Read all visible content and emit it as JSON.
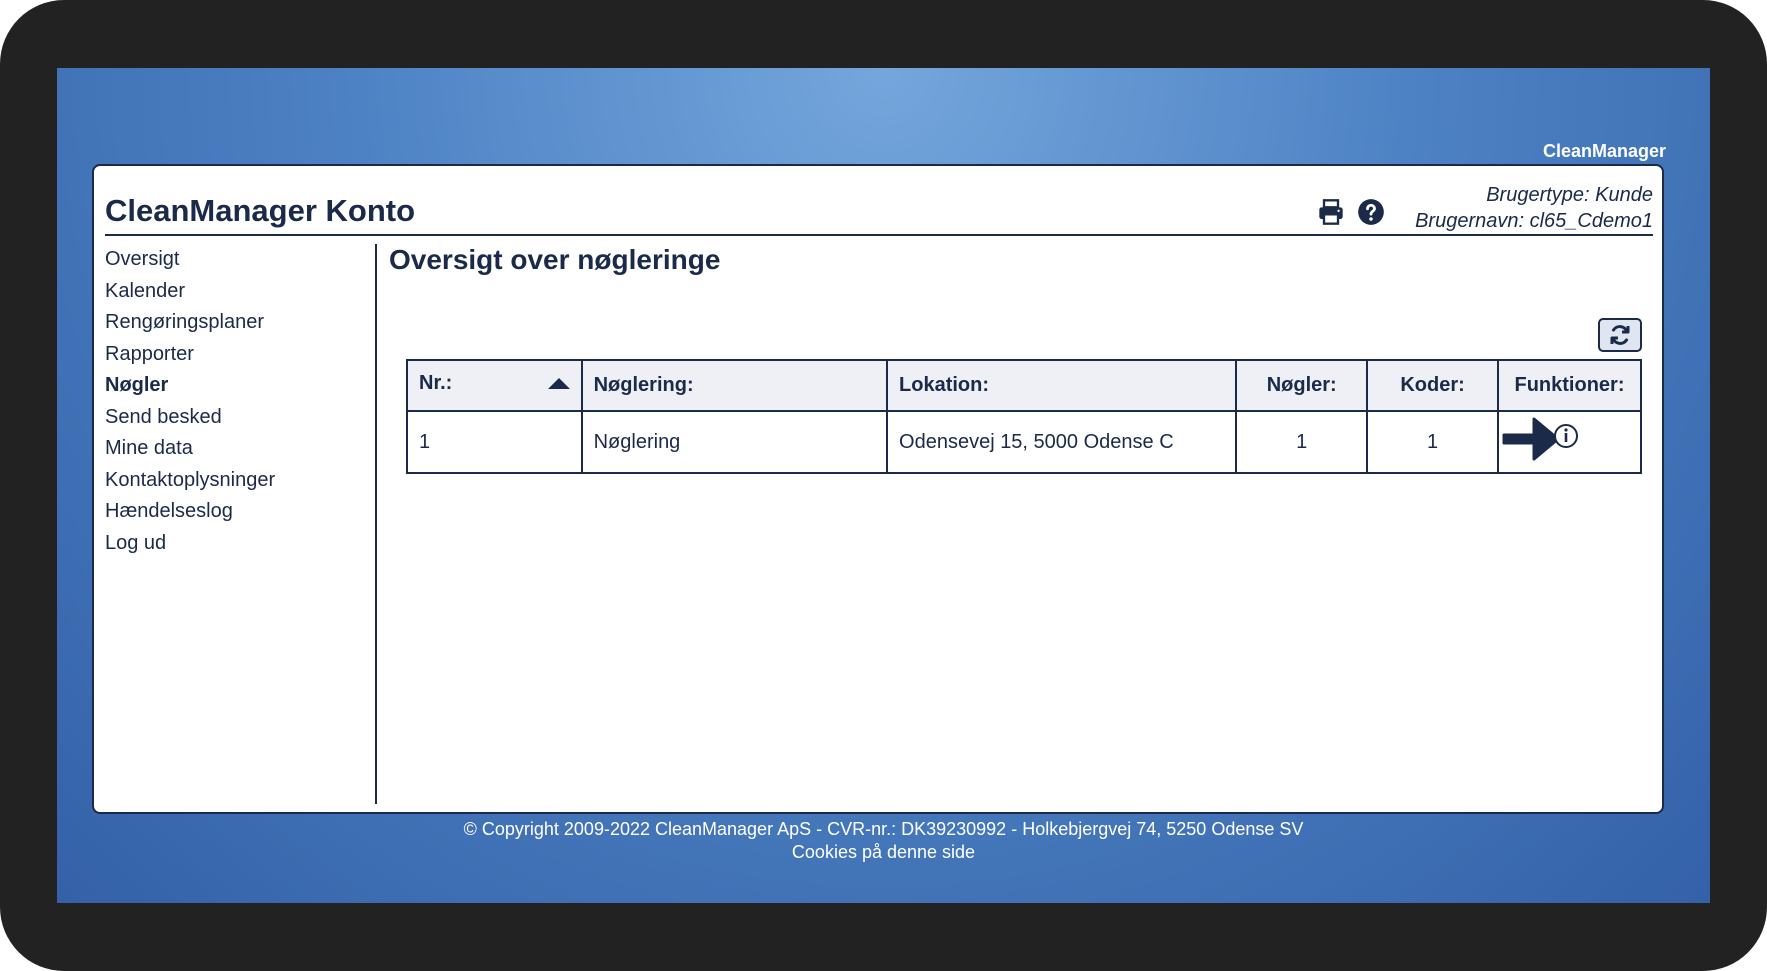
{
  "brand": "CleanManager",
  "panel": {
    "title": "CleanManager Konto",
    "user_type": "Brugertype: Kunde",
    "user_name": "Brugernavn: cl65_Cdemo1"
  },
  "header_icons": [
    "printer-icon",
    "help-icon"
  ],
  "sidebar": {
    "items": [
      {
        "label": "Oversigt",
        "active": false
      },
      {
        "label": "Kalender",
        "active": false
      },
      {
        "label": "Rengøringsplaner",
        "active": false
      },
      {
        "label": "Rapporter",
        "active": false
      },
      {
        "label": "Nøgler",
        "active": true
      },
      {
        "label": "Send besked",
        "active": false
      },
      {
        "label": "Mine data",
        "active": false
      },
      {
        "label": "Kontaktoplysninger",
        "active": false
      },
      {
        "label": "Hændelseslog",
        "active": false
      },
      {
        "label": "Log ud",
        "active": false
      }
    ]
  },
  "content": {
    "title": "Oversigt over nøgleringe",
    "table": {
      "headers": [
        "Nr.:",
        "Nøglering:",
        "Lokation:",
        "Nøgler:",
        "Koder:",
        "Funktioner:"
      ],
      "rows": [
        [
          "1",
          "Nøglering",
          "Odensevej 15, 5000 Odense C",
          "1",
          "1"
        ]
      ]
    }
  },
  "footer": {
    "copyright": "© Copyright 2009-2022 CleanManager ApS - CVR-nr.: DK39230992 - Holkebjergvej 74, 5250 Odense SV",
    "cookies": "Cookies på denne side"
  },
  "colors": {
    "navy": "#1a2a48",
    "header_bg": "#eef0f5",
    "background_blue": "#4d82c4"
  }
}
